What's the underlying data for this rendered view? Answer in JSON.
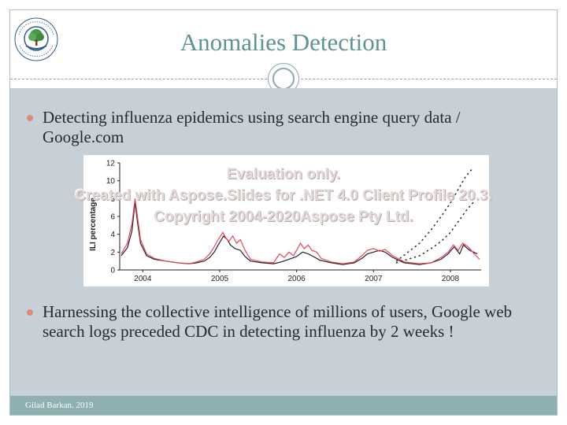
{
  "slide": {
    "title": "Anomalies Detection",
    "footer": "Gilad Barkan. 2019",
    "logo_icon": "academic-center-tree-logo"
  },
  "bullets": [
    "Detecting influenza epidemics using search engine query data / Google.com",
    "Harnessing the collective intelligence of millions of users, Google web search logs preceded CDC in detecting influenza by 2 weeks !"
  ],
  "watermark": {
    "line1": "Evaluation only.",
    "line2": "Created with Aspose.Slides for .NET 4.0 Client Profile 20.3.",
    "line3": "Copyright 2004-2020Aspose Pty Ltd."
  },
  "colors": {
    "title": "#5f9292",
    "bullet": "#e08a73",
    "body_bg": "#c6d0d6",
    "footer_bg": "#8fb0b1",
    "series_google": "#e8435a",
    "series_cdc": "#222222"
  },
  "chart_data": {
    "type": "line",
    "ylabel": "ILI percentage",
    "ylim": [
      0,
      12
    ],
    "yticks": [
      "0",
      "2",
      "4",
      "6",
      "8",
      "10",
      "12"
    ],
    "xlim": [
      2003.7,
      2008.4
    ],
    "xticks": [
      "2004",
      "2005",
      "2006",
      "2007",
      "2008"
    ],
    "series": [
      {
        "key": "cdc",
        "color": "#222222",
        "style": "solid",
        "points": [
          [
            2003.72,
            1.6
          ],
          [
            2003.8,
            2.5
          ],
          [
            2003.86,
            4.4
          ],
          [
            2003.9,
            7.6
          ],
          [
            2003.93,
            5.4
          ],
          [
            2003.97,
            3.0
          ],
          [
            2004.05,
            1.6
          ],
          [
            2004.15,
            1.2
          ],
          [
            2004.3,
            1.0
          ],
          [
            2004.45,
            0.8
          ],
          [
            2004.6,
            0.7
          ],
          [
            2004.7,
            0.8
          ],
          [
            2004.8,
            1.0
          ],
          [
            2004.87,
            1.4
          ],
          [
            2004.93,
            2.0
          ],
          [
            2004.98,
            2.8
          ],
          [
            2005.05,
            3.8
          ],
          [
            2005.1,
            3.4
          ],
          [
            2005.14,
            2.8
          ],
          [
            2005.2,
            2.4
          ],
          [
            2005.27,
            2.2
          ],
          [
            2005.33,
            1.5
          ],
          [
            2005.4,
            1.0
          ],
          [
            2005.55,
            0.8
          ],
          [
            2005.7,
            0.7
          ],
          [
            2005.8,
            0.9
          ],
          [
            2005.9,
            1.2
          ],
          [
            2006.0,
            1.5
          ],
          [
            2006.08,
            2.0
          ],
          [
            2006.15,
            1.8
          ],
          [
            2006.22,
            1.5
          ],
          [
            2006.3,
            1.1
          ],
          [
            2006.45,
            0.8
          ],
          [
            2006.6,
            0.6
          ],
          [
            2006.75,
            0.8
          ],
          [
            2006.85,
            1.3
          ],
          [
            2006.92,
            1.8
          ],
          [
            2007.0,
            2.0
          ],
          [
            2007.08,
            2.2
          ],
          [
            2007.15,
            2.0
          ],
          [
            2007.25,
            1.4
          ],
          [
            2007.4,
            0.8
          ],
          [
            2007.6,
            0.6
          ],
          [
            2007.75,
            0.8
          ],
          [
            2007.88,
            1.2
          ],
          [
            2007.97,
            1.8
          ],
          [
            2008.05,
            2.6
          ],
          [
            2008.12,
            1.8
          ],
          [
            2008.17,
            2.8
          ],
          [
            2008.25,
            2.2
          ],
          [
            2008.35,
            1.8
          ]
        ]
      },
      {
        "key": "google",
        "color": "#e8435a",
        "style": "solid",
        "points": [
          [
            2003.72,
            1.8
          ],
          [
            2003.8,
            3.0
          ],
          [
            2003.86,
            5.2
          ],
          [
            2003.9,
            8.0
          ],
          [
            2003.93,
            6.0
          ],
          [
            2003.97,
            3.4
          ],
          [
            2004.05,
            1.8
          ],
          [
            2004.15,
            1.3
          ],
          [
            2004.3,
            1.0
          ],
          [
            2004.45,
            0.8
          ],
          [
            2004.6,
            0.7
          ],
          [
            2004.7,
            0.9
          ],
          [
            2004.8,
            1.2
          ],
          [
            2004.87,
            1.8
          ],
          [
            2004.93,
            2.6
          ],
          [
            2004.98,
            3.4
          ],
          [
            2005.04,
            4.2
          ],
          [
            2005.08,
            3.6
          ],
          [
            2005.12,
            3.2
          ],
          [
            2005.17,
            3.8
          ],
          [
            2005.22,
            3.0
          ],
          [
            2005.27,
            3.4
          ],
          [
            2005.33,
            2.2
          ],
          [
            2005.4,
            1.2
          ],
          [
            2005.55,
            0.9
          ],
          [
            2005.7,
            0.8
          ],
          [
            2005.78,
            1.8
          ],
          [
            2005.84,
            1.4
          ],
          [
            2005.9,
            2.0
          ],
          [
            2005.96,
            1.6
          ],
          [
            2006.0,
            2.2
          ],
          [
            2006.05,
            3.0
          ],
          [
            2006.1,
            2.4
          ],
          [
            2006.15,
            2.8
          ],
          [
            2006.2,
            2.2
          ],
          [
            2006.26,
            2.0
          ],
          [
            2006.32,
            1.3
          ],
          [
            2006.45,
            0.9
          ],
          [
            2006.6,
            0.7
          ],
          [
            2006.75,
            0.9
          ],
          [
            2006.85,
            1.6
          ],
          [
            2006.92,
            2.2
          ],
          [
            2007.0,
            2.4
          ],
          [
            2007.08,
            2.1
          ],
          [
            2007.15,
            2.3
          ],
          [
            2007.25,
            1.6
          ],
          [
            2007.4,
            0.9
          ],
          [
            2007.6,
            0.7
          ],
          [
            2007.75,
            0.8
          ],
          [
            2007.88,
            1.4
          ],
          [
            2007.97,
            2.0
          ],
          [
            2008.04,
            2.8
          ],
          [
            2008.1,
            2.2
          ],
          [
            2008.16,
            3.0
          ],
          [
            2008.23,
            2.6
          ],
          [
            2008.3,
            1.9
          ],
          [
            2008.38,
            1.2
          ]
        ]
      },
      {
        "key": "forecast",
        "color": "#333333",
        "style": "dotted",
        "points": [
          [
            2007.3,
            1.0
          ],
          [
            2007.45,
            2.0
          ],
          [
            2007.6,
            3.0
          ],
          [
            2007.75,
            4.5
          ],
          [
            2007.88,
            6.0
          ],
          [
            2008.0,
            7.5
          ],
          [
            2008.1,
            9.0
          ],
          [
            2008.2,
            10.5
          ],
          [
            2008.3,
            11.5
          ]
        ]
      },
      {
        "key": "forecast-low",
        "color": "#333333",
        "style": "dotted",
        "points": [
          [
            2007.3,
            0.8
          ],
          [
            2007.45,
            1.2
          ],
          [
            2007.6,
            1.6
          ],
          [
            2007.75,
            2.4
          ],
          [
            2007.88,
            3.2
          ],
          [
            2008.0,
            4.2
          ],
          [
            2008.1,
            5.4
          ],
          [
            2008.2,
            6.6
          ],
          [
            2008.3,
            7.6
          ]
        ]
      }
    ]
  }
}
